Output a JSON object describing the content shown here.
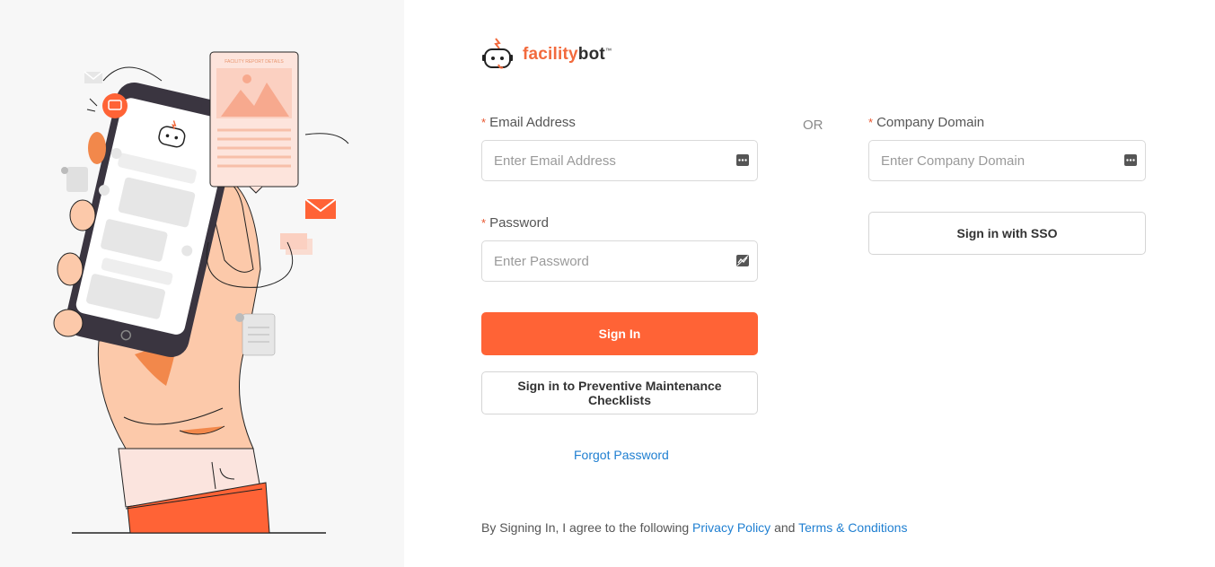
{
  "brand": {
    "name_part1": "facility",
    "name_part2": "bot",
    "trademark": "™",
    "accent": "#ff6336"
  },
  "illustration": {
    "report_title": "FACILITY REPORT DETAILS"
  },
  "login": {
    "email_label": "Email Address",
    "email_placeholder": "Enter Email Address",
    "password_label": "Password",
    "password_placeholder": "Enter Password",
    "required_marker": "*",
    "sign_in_button": "Sign In",
    "checklists_button": "Sign in to Preventive Maintenance Checklists",
    "forgot_password": "Forgot Password"
  },
  "divider": {
    "or": "OR"
  },
  "sso": {
    "domain_label": "Company Domain",
    "domain_placeholder": "Enter Company Domain",
    "sso_button": "Sign in with SSO"
  },
  "footer": {
    "prefix": "By Signing In, I agree to the following",
    "privacy": "Privacy Policy",
    "and": "and",
    "terms": "Terms & Conditions"
  },
  "icons": [
    "robot-logo-icon",
    "autofill-key-icon",
    "password-visibility-icon"
  ]
}
